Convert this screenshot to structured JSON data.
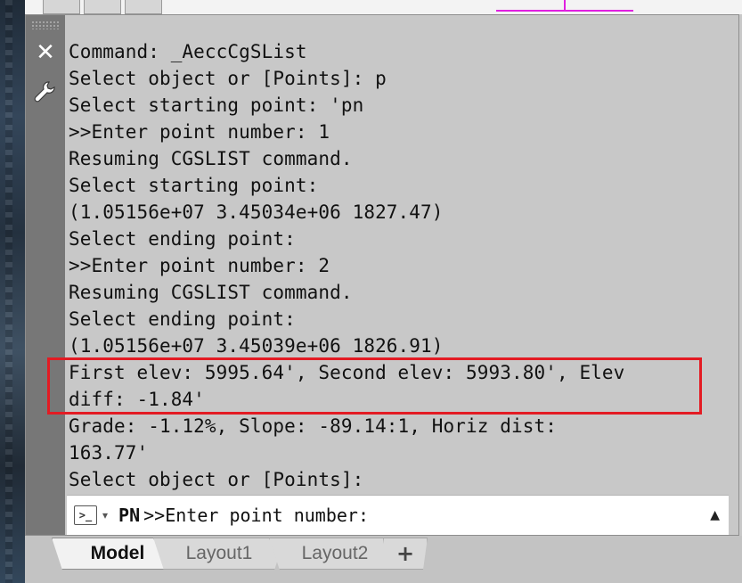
{
  "history": [
    "Command: _AeccCgSList",
    "Select object or [Points]: p",
    "Select starting point: 'pn",
    ">>Enter point number: 1",
    "Resuming CGSLIST command.",
    "Select starting point:",
    "(1.05156e+07 3.45034e+06 1827.47)",
    "Select ending point:",
    ">>Enter point number: 2",
    "Resuming CGSLIST command.",
    "Select ending point:",
    "(1.05156e+07 3.45039e+06 1826.91)",
    "First elev: 5995.64', Second elev: 5993.80', Elev",
    "diff: -1.84'",
    "Grade: -1.12%, Slope: -89.14:1, Horiz dist:",
    "163.77'",
    "Select object or [Points]:"
  ],
  "input": {
    "icon": "command-prompt-icon",
    "pn": "PN",
    "prompt": ">>Enter point number:"
  },
  "tabs": [
    {
      "label": "Model",
      "active": true
    },
    {
      "label": "Layout1",
      "active": false
    },
    {
      "label": "Layout2",
      "active": false
    }
  ],
  "icons": {
    "close": "close-icon",
    "settings": "wrench-icon",
    "add_tab": "plus-icon",
    "history_toggle": "triangle-up-icon"
  },
  "colors": {
    "highlight": "#e31b23",
    "magenta_line": "#e020e0"
  }
}
